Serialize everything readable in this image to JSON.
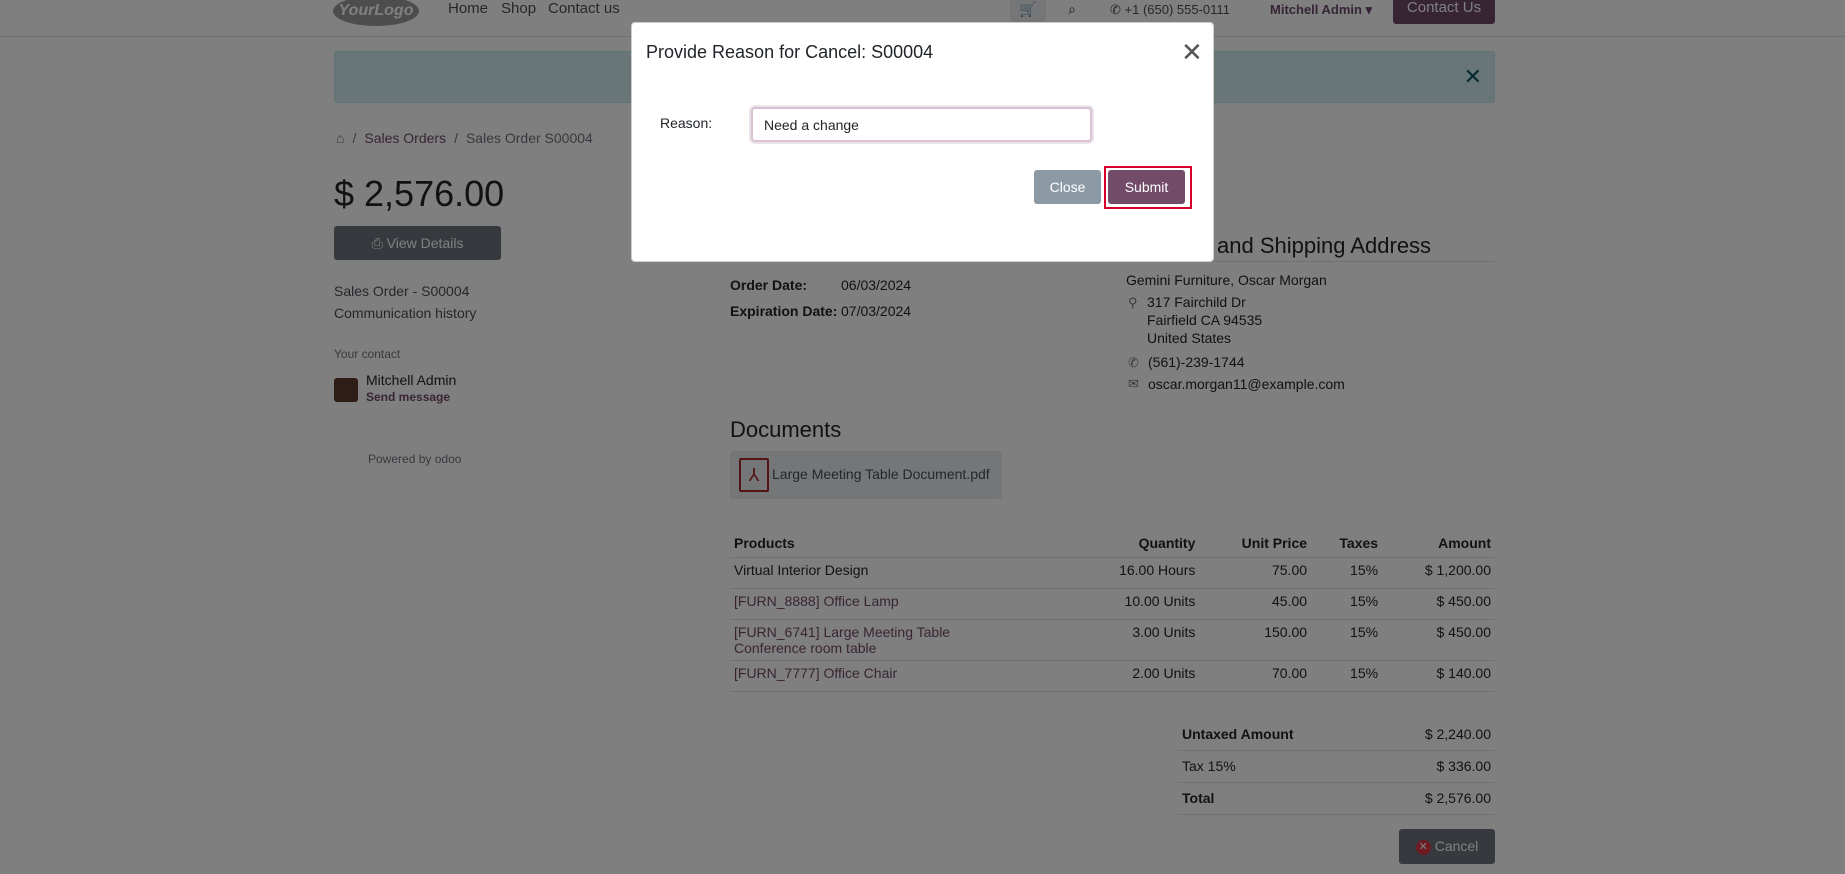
{
  "navbar": {
    "logo_text": "YourLogo",
    "links": [
      "Home",
      "Shop",
      "Contact us"
    ],
    "phone": "+1 (650) 555-0111",
    "user": "Mitchell Admin",
    "contact_button": "Contact Us"
  },
  "breadcrumb": {
    "home_icon": "⌂",
    "separator": "/",
    "items": [
      "Sales Orders",
      "Sales Order S00004"
    ]
  },
  "sidebar": {
    "amount": "$ 2,576.00",
    "view_details": "View Details",
    "print_icon": "⎙",
    "links": [
      "Sales Order - S00004",
      "Communication history"
    ],
    "your_contact_label": "Your contact",
    "contact_name": "Mitchell Admin",
    "send_message": "Send message",
    "powered_by": "Powered by",
    "powered_brand": "odoo"
  },
  "order_info": {
    "order_date_label": "Order Date:",
    "order_date": "06/03/2024",
    "expiration_date_label": "Expiration Date:",
    "expiration_date": "07/03/2024"
  },
  "address": {
    "title": "and Shipping Address",
    "name": "Gemini Furniture, Oscar Morgan",
    "street": "317 Fairchild Dr",
    "city": "Fairfield CA 94535",
    "country": "United States",
    "phone": "(561)-239-1744",
    "email": "oscar.morgan11@example.com"
  },
  "documents": {
    "title": "Documents",
    "file": "Large Meeting Table Document.pdf"
  },
  "products_table": {
    "headers": [
      "Products",
      "Quantity",
      "Unit Price",
      "Taxes",
      "Amount"
    ],
    "rows": [
      {
        "name": "Virtual Interior Design",
        "desc": "",
        "qty": "16.00 Hours",
        "price": "75.00",
        "tax": "15%",
        "amount": "$ 1,200.00"
      },
      {
        "name": "[FURN_8888] Office Lamp",
        "desc": "",
        "qty": "10.00 Units",
        "price": "45.00",
        "tax": "15%",
        "amount": "$ 450.00"
      },
      {
        "name": "[FURN_6741] Large Meeting Table",
        "desc": "Conference room table",
        "qty": "3.00 Units",
        "price": "150.00",
        "tax": "15%",
        "amount": "$ 450.00"
      },
      {
        "name": "[FURN_7777] Office Chair",
        "desc": "",
        "qty": "2.00 Units",
        "price": "70.00",
        "tax": "15%",
        "amount": "$ 140.00"
      }
    ]
  },
  "totals": {
    "untaxed_label": "Untaxed Amount",
    "untaxed": "$ 2,240.00",
    "tax_label": "Tax 15%",
    "tax": "$ 336.00",
    "total_label": "Total",
    "total": "$ 2,576.00"
  },
  "cancel_button": "Cancel",
  "modal": {
    "title": "Provide Reason for Cancel: S00004",
    "reason_label": "Reason:",
    "reason_value": "Need a change",
    "close_label": "Close",
    "submit_label": "Submit"
  },
  "colors": {
    "brand": "#714b67",
    "alert_bg": "#d1ecf1",
    "highlight": "#d6002a"
  }
}
